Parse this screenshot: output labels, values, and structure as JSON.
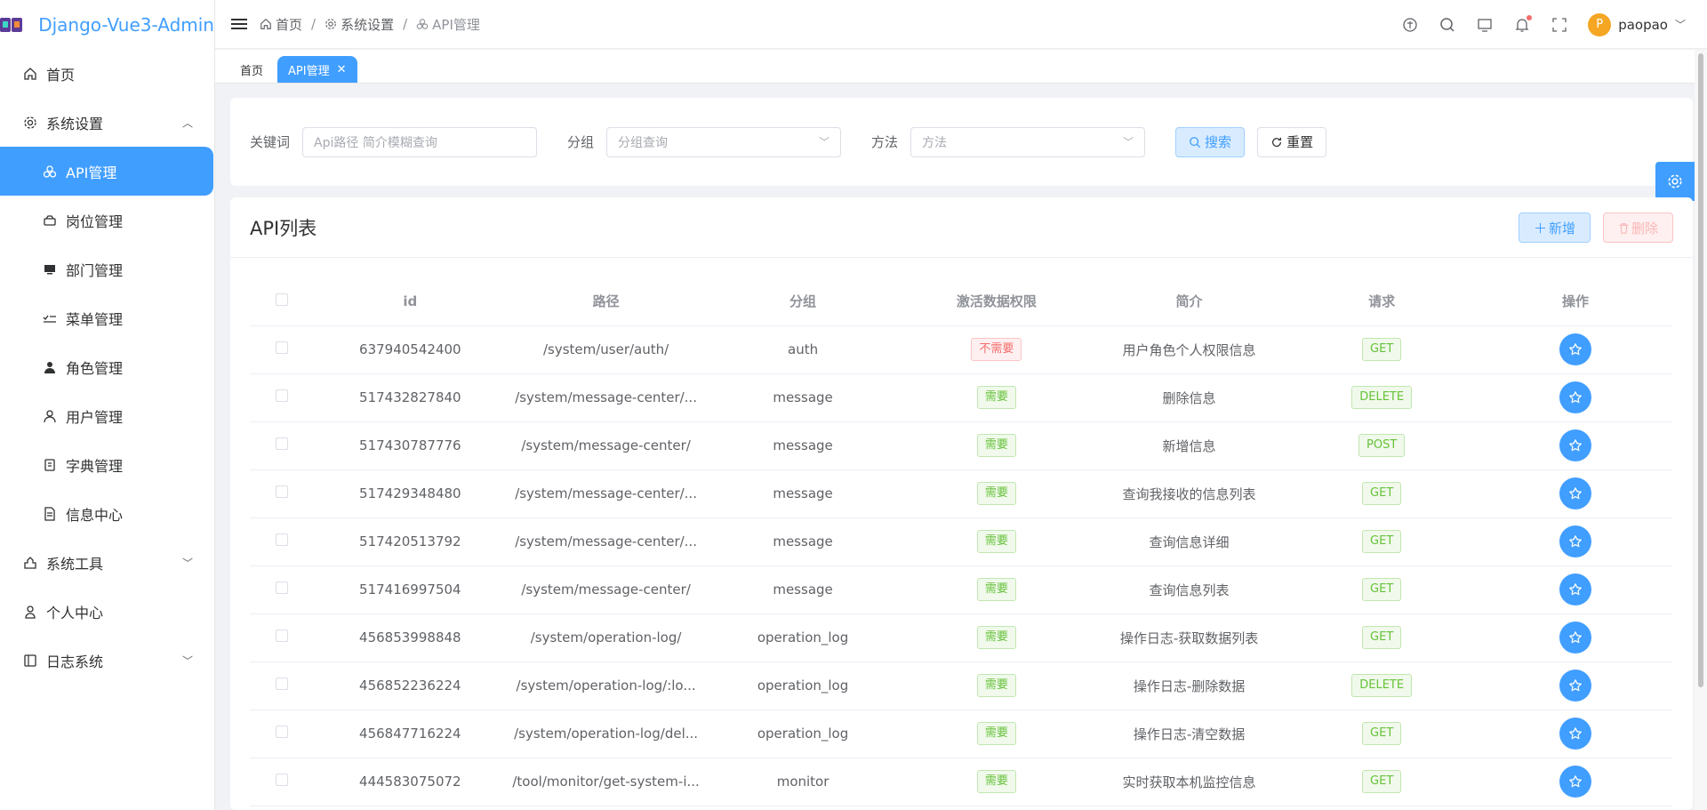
{
  "app": {
    "title": "Django-Vue3-Admin"
  },
  "sidebar": {
    "items": [
      {
        "label": "首页",
        "icon": "home-icon"
      },
      {
        "label": "系统设置",
        "icon": "gear-icon"
      },
      {
        "label": "API管理",
        "icon": "api-icon"
      },
      {
        "label": "岗位管理",
        "icon": "post-icon"
      },
      {
        "label": "部门管理",
        "icon": "monitor-icon"
      },
      {
        "label": "菜单管理",
        "icon": "list-check-icon"
      },
      {
        "label": "角色管理",
        "icon": "user-filled-icon"
      },
      {
        "label": "用户管理",
        "icon": "user-icon"
      },
      {
        "label": "字典管理",
        "icon": "dictionary-icon"
      },
      {
        "label": "信息中心",
        "icon": "document-icon"
      },
      {
        "label": "系统工具",
        "icon": "toolbox-icon"
      },
      {
        "label": "个人中心",
        "icon": "person-icon"
      },
      {
        "label": "日志系统",
        "icon": "log-icon"
      }
    ]
  },
  "header": {
    "breadcrumb": [
      "首页",
      "系统设置",
      "API管理"
    ],
    "user": {
      "initial": "P",
      "name": "paopao"
    }
  },
  "tags": [
    {
      "label": "首页"
    },
    {
      "label": "API管理"
    }
  ],
  "search": {
    "keyword_label": "关键词",
    "keyword_placeholder": "Api路径 简介模糊查询",
    "group_label": "分组",
    "group_placeholder": "分组查询",
    "method_label": "方法",
    "method_placeholder": "方法",
    "search_button": "搜索",
    "reset_button": "重置"
  },
  "table": {
    "title": "API列表",
    "add_button": "新增",
    "delete_button": "删除",
    "columns": [
      "id",
      "路径",
      "分组",
      "激活数据权限",
      "简介",
      "请求",
      "操作"
    ],
    "rows": [
      {
        "id": "637940542400",
        "path": "/system/user/auth/",
        "group": "auth",
        "perm": "不需要",
        "desc": "用户角色个人权限信息",
        "method": "GET"
      },
      {
        "id": "517432827840",
        "path": "/system/message-center/...",
        "group": "message",
        "perm": "需要",
        "desc": "删除信息",
        "method": "DELETE"
      },
      {
        "id": "517430787776",
        "path": "/system/message-center/",
        "group": "message",
        "perm": "需要",
        "desc": "新增信息",
        "method": "POST"
      },
      {
        "id": "517429348480",
        "path": "/system/message-center/...",
        "group": "message",
        "perm": "需要",
        "desc": "查询我接收的信息列表",
        "method": "GET"
      },
      {
        "id": "517420513792",
        "path": "/system/message-center/...",
        "group": "message",
        "perm": "需要",
        "desc": "查询信息详细",
        "method": "GET"
      },
      {
        "id": "517416997504",
        "path": "/system/message-center/",
        "group": "message",
        "perm": "需要",
        "desc": "查询信息列表",
        "method": "GET"
      },
      {
        "id": "456853998848",
        "path": "/system/operation-log/",
        "group": "operation_log",
        "perm": "需要",
        "desc": "操作日志-获取数据列表",
        "method": "GET"
      },
      {
        "id": "456852236224",
        "path": "/system/operation-log/:lo...",
        "group": "operation_log",
        "perm": "需要",
        "desc": "操作日志-删除数据",
        "method": "DELETE"
      },
      {
        "id": "456847716224",
        "path": "/system/operation-log/del...",
        "group": "operation_log",
        "perm": "需要",
        "desc": "操作日志-清空数据",
        "method": "GET"
      },
      {
        "id": "444583075072",
        "path": "/tool/monitor/get-system-i...",
        "group": "monitor",
        "perm": "需要",
        "desc": "实时获取本机监控信息",
        "method": "GET"
      }
    ]
  },
  "colors": {
    "primary": "#409eff",
    "success": "#67c23a",
    "danger": "#f56c6c"
  }
}
